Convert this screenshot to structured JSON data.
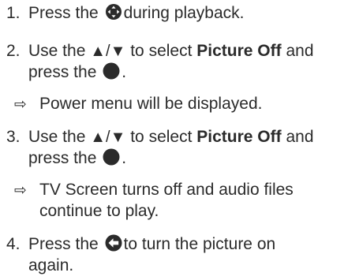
{
  "steps": [
    {
      "number": "1.",
      "before": "Press the",
      "icon": "navigation-dpad-icon",
      "after": "during playback."
    },
    {
      "number": "2.",
      "line1_before": "Use the",
      "arrows": "▲/▼",
      "line1_mid": "to select",
      "bold": "Picture Off",
      "line1_after": "and",
      "line2_before": "press the",
      "icon": "ok-button-icon",
      "line2_after": ".",
      "result": "Power menu will be displayed."
    },
    {
      "number": "3.",
      "line1_before": "Use the",
      "arrows": "▲/▼",
      "line1_mid": "to select",
      "bold": "Picture Off",
      "line1_after": "and",
      "line2_before": "press the",
      "icon": "ok-button-icon",
      "line2_after": ".",
      "result_line1": "TV Screen turns off and audio files",
      "result_line2": "continue to play."
    },
    {
      "number": "4.",
      "before": "Press the",
      "icon": "back-arrow-icon",
      "after": "to turn the picture on",
      "line2": "again."
    }
  ],
  "result_marker": "⇨"
}
